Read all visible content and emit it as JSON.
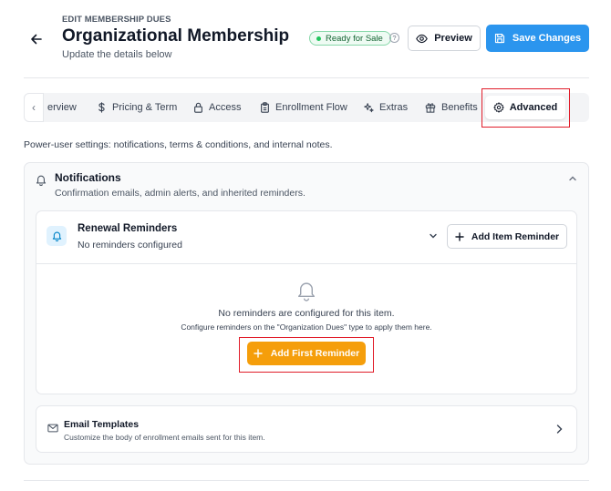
{
  "header": {
    "eyebrow": "EDIT MEMBERSHIP DUES",
    "title": "Organizational Membership",
    "subtitle": "Update the details below",
    "status": "Ready for Sale",
    "help_glyph": "?",
    "preview_label": "Preview",
    "save_label": "Save Changes"
  },
  "tabs": {
    "scroll_left_glyph": "‹",
    "items": [
      {
        "label": "erview",
        "icon": "overview-icon"
      },
      {
        "label": "Pricing & Term",
        "icon": "dollar-icon"
      },
      {
        "label": "Access",
        "icon": "lock-icon"
      },
      {
        "label": "Enrollment Flow",
        "icon": "clipboard-icon"
      },
      {
        "label": "Extras",
        "icon": "sparkles-icon"
      },
      {
        "label": "Benefits",
        "icon": "gift-icon"
      },
      {
        "label": "Advanced",
        "icon": "gear-icon",
        "active": true
      }
    ]
  },
  "intro": "Power-user settings: notifications, terms & conditions, and internal notes.",
  "notifications": {
    "title": "Notifications",
    "subtitle": "Confirmation emails, admin alerts, and inherited reminders.",
    "renewal": {
      "title": "Renewal Reminders",
      "subtitle": "No reminders configured",
      "add_item_label": "Add Item Reminder",
      "empty_title": "No reminders are configured for this item.",
      "empty_subtitle": "Configure reminders on the \"Organization Dues\" type to apply them here.",
      "add_first_label": "Add First Reminder"
    },
    "email_templates": {
      "title": "Email Templates",
      "subtitle": "Customize the body of enrollment emails sent for this item."
    }
  },
  "colors": {
    "primary": "#2b95ee",
    "accent_orange": "#f59e0b",
    "status_green": "#22c55e",
    "highlight_red": "#e11d2a"
  }
}
